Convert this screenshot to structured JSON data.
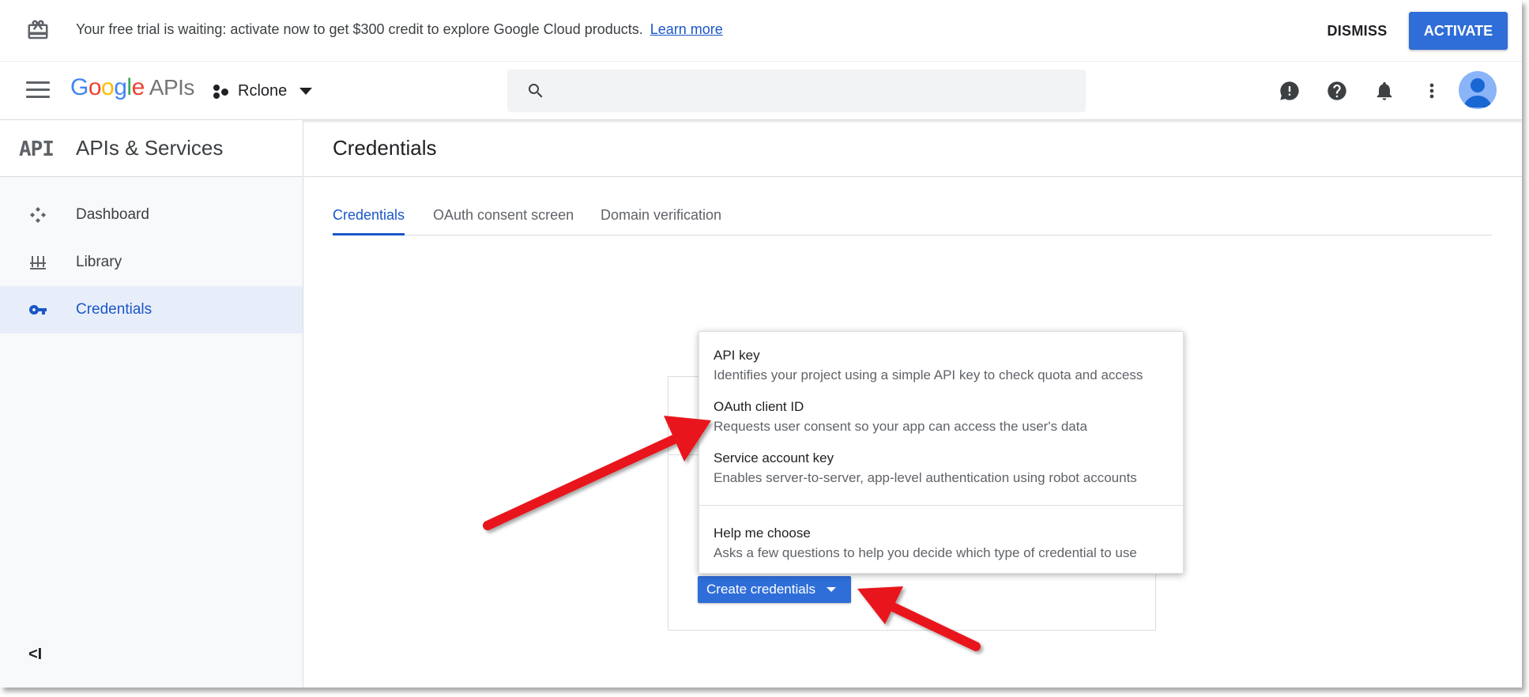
{
  "banner": {
    "message": "Your free trial is waiting: activate now to get $300 credit to explore Google Cloud products.",
    "learn_more": "Learn more",
    "dismiss_label": "DISMISS",
    "activate_label": "ACTIVATE"
  },
  "appbar": {
    "logo_google": [
      "G",
      "o",
      "o",
      "g",
      "l",
      "e"
    ],
    "logo_suffix": "APIs",
    "project_name": "Rclone",
    "search_placeholder": ""
  },
  "sidebar": {
    "logo_text": "API",
    "title": "APIs & Services",
    "items": [
      {
        "label": "Dashboard",
        "icon": "dashboard-icon",
        "active": false
      },
      {
        "label": "Library",
        "icon": "library-icon",
        "active": false
      },
      {
        "label": "Credentials",
        "icon": "key-icon",
        "active": true
      }
    ],
    "collapse_label": "<I"
  },
  "main": {
    "title": "Credentials",
    "tabs": [
      {
        "label": "Credentials",
        "active": true
      },
      {
        "label": "OAuth consent screen",
        "active": false
      },
      {
        "label": "Domain verification",
        "active": false
      }
    ],
    "create_button_label": "Create credentials"
  },
  "menu": {
    "items": [
      {
        "title": "API key",
        "description": "Identifies your project using a simple API key to check quota and access"
      },
      {
        "title": "OAuth client ID",
        "description": "Requests user consent so your app can access the user's data"
      },
      {
        "title": "Service account key",
        "description": "Enables server-to-server, app-level authentication using robot accounts"
      },
      {
        "title": "Help me choose",
        "description": "Asks a few questions to help you decide which type of credential to use"
      }
    ]
  },
  "colors": {
    "accent": "#1a56c8",
    "button_blue": "#2f6ed8",
    "annotation_arrow": "#e8141b"
  }
}
